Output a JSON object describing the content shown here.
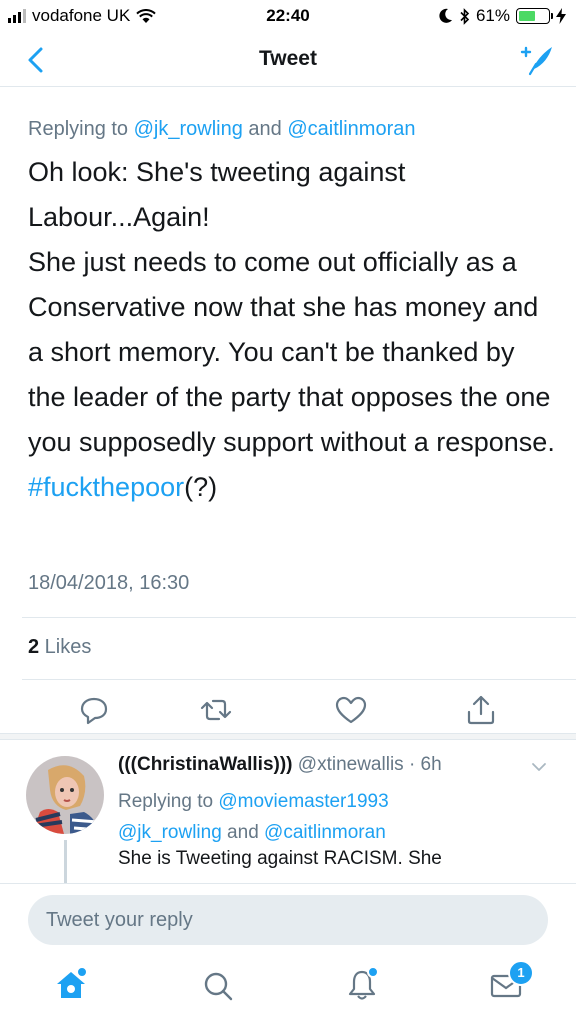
{
  "status_bar": {
    "carrier": "vodafone UK",
    "time": "22:40",
    "battery_percent": "61%",
    "battery_level": 0.61
  },
  "nav": {
    "title": "Tweet",
    "back_icon": "chevron-left-icon",
    "compose_icon": "compose-tweet-icon"
  },
  "tweet": {
    "replying_prefix": "Replying to ",
    "reply_to_1": "@jk_rowling",
    "reply_and": " and ",
    "reply_to_2": "@caitlinmoran",
    "line1": "Oh look: She's tweeting against Labour...Again!",
    "line2": "She just needs to come out officially as a Conservative now that she has money and a short memory. You can't be thanked by the leader of the party that opposes the one you supposedly support without a response.",
    "hashtag": "#fuckthepoor",
    "hashtag_suffix": "(?)",
    "timestamp": "18/04/2018, 16:30",
    "likes_count": "2",
    "likes_label": " Likes"
  },
  "reply": {
    "name": "(((ChristinaWallis)))",
    "handle_time": " @xtinewallis · 6h",
    "replying_prefix": "Replying to ",
    "reply_to_1": "@moviemaster1993",
    "reply_to_2": "@jk_rowling",
    "reply_and": " and ",
    "reply_to_3": "@caitlinmoran",
    "text": "She is Tweeting against RACISM. She"
  },
  "reply_bar": {
    "placeholder": "Tweet your reply"
  },
  "tabbar": {
    "messages_badge": "1"
  },
  "colors": {
    "accent": "#1da1f2",
    "muted": "#657786",
    "text": "#14171a"
  }
}
